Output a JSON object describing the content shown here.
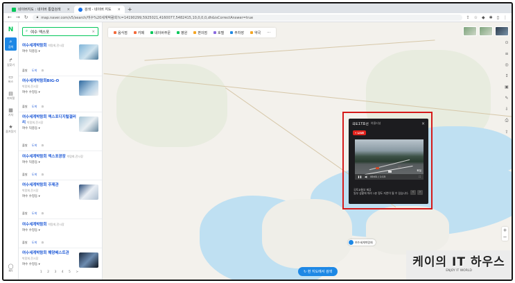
{
  "browser": {
    "tabs": [
      {
        "title": "네이버지도 : 네이버 통합검색"
      },
      {
        "title": "검색 - 네이버 지도"
      }
    ],
    "new_tab": "+",
    "url": "map.naver.com/v5/search/여수%20세계박람회?c=14190299,5925021,4160077,5482415,10,0,0,0,dh&isCorrectAnswer=true"
  },
  "rail": {
    "logo": "N",
    "items": [
      {
        "label": "검색",
        "glyph": "⌕"
      },
      {
        "label": "길찾기",
        "glyph": "↱"
      },
      {
        "label": "버스",
        "glyph": "▭"
      },
      {
        "label": "지하철",
        "glyph": "▤"
      },
      {
        "label": "기차",
        "glyph": "▦"
      },
      {
        "label": "즐겨찾기",
        "glyph": "★"
      },
      {
        "label": "MY",
        "glyph": "◯"
      }
    ]
  },
  "search": {
    "query": "여수 엑스포",
    "clear": "×"
  },
  "results": [
    {
      "name": "여수세계박람회",
      "category": "박람회,전시장",
      "sub": "여수 덕충동 ▾",
      "actions": [
        "출발",
        "도착",
        "⊙"
      ]
    },
    {
      "name": "여수세계박람회BIG-O",
      "category": "박람회,전시장",
      "sub": "여수 수정동 ▾",
      "actions": [
        "출발",
        "도착",
        "⊙"
      ]
    },
    {
      "name": "여수세계박람회 엑스포디지털갤러리",
      "category": "박람회,전시장",
      "sub": "여수 덕충동 ▾",
      "actions": [
        "출발",
        "도착",
        "⊙"
      ]
    },
    {
      "name": "여수세계박람회 엑스포광장",
      "category": "박람회,전시장",
      "sub": "여수 덕충동 ▾",
      "actions": [
        "출발",
        "도착",
        "⊙"
      ]
    },
    {
      "name": "여수세계박람회 주제관",
      "category": "박람회,전시장",
      "sub": "여수 수정동 ▾",
      "actions": [
        "출발",
        "도착",
        "⊙"
      ]
    },
    {
      "name": "여수세계박람회",
      "category": "박람회,전시장",
      "sub": "여수 수정동 ▾",
      "actions": [
        "출발",
        "도착",
        "⊙"
      ]
    },
    {
      "name": "여수세계박람회 해양베스트관",
      "category": "박람회,전시장",
      "sub": "여수 수정동 ▾",
      "actions": [
        "출발",
        "도착",
        "⊙"
      ]
    }
  ],
  "pager": "1 2 3 4 5 >",
  "map": {
    "categories": [
      {
        "label": "음식점",
        "color": "#f36b3b"
      },
      {
        "label": "카페",
        "color": "#f36b3b"
      },
      {
        "label": "네이버주문",
        "color": "#03c75a"
      },
      {
        "label": "병원",
        "color": "#03c75a"
      },
      {
        "label": "편의점",
        "color": "#f5a623"
      },
      {
        "label": "호텔",
        "color": "#8a6bdf"
      },
      {
        "label": "주차장",
        "color": "#1e88e5"
      },
      {
        "label": "약국",
        "color": "#f5a623"
      },
      {
        "label": "···",
        "color": "#ffffff"
      }
    ],
    "pin_label": "여수세계박람회",
    "reload_label": "현 지도에서 검색",
    "zoom_in": "+",
    "zoom_out": "−"
  },
  "cctv": {
    "title": "국도17호선",
    "camera": "여름터널",
    "live_badge": "• LIVE",
    "close": "×",
    "time": "00:01 / 1:15",
    "tag": "화질",
    "notice_1": "국토교통부 제공",
    "notice_2": "일부 상황에 따라 1분 정도 지연이 될 수 있습니다.",
    "prev": "‹",
    "next": "›"
  },
  "watermark": {
    "title": "케이의 IT 하우스",
    "subtitle": "ENJOY IT WORLD"
  }
}
